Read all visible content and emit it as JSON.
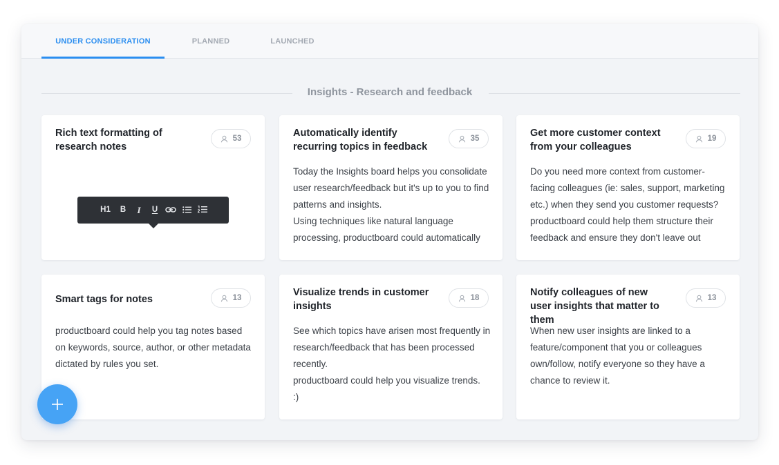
{
  "tabs": [
    {
      "label": "UNDER CONSIDERATION",
      "active": true
    },
    {
      "label": "PLANNED",
      "active": false
    },
    {
      "label": "LAUNCHED",
      "active": false
    }
  ],
  "section": {
    "title": "Insights - Research and feedback"
  },
  "colors": {
    "accent": "#2b8ef0",
    "fab": "#46a3f5",
    "toolbar": "#2e3136"
  },
  "cards": [
    {
      "title": "Rich text formatting of research notes",
      "votes": "53",
      "body": []
    },
    {
      "title": "Automatically identify recurring topics in feedback",
      "votes": "35",
      "body": [
        "Today the Insights board helps you consolidate user research/feedback but it's up to you to find patterns and insights.",
        "Using techniques like natural language processing, productboard could automatically"
      ]
    },
    {
      "title": "Get more customer context from your colleagues",
      "votes": "19",
      "body": [
        "Do you need more context from customer-facing colleagues (ie: sales, support, marketing etc.) when they send you customer requests? productboard could help them structure their feedback and ensure they don't leave out"
      ]
    },
    {
      "title": "Smart tags for notes",
      "votes": "13",
      "body": [
        "productboard could help you tag notes based on keywords, source, author, or other metadata dictated by rules you set."
      ]
    },
    {
      "title": "Visualize trends in customer insights",
      "votes": "18",
      "body": [
        "See which topics have arisen most frequently in research/feedback that has been processed recently.",
        "productboard could help you visualize trends.",
        ":)"
      ]
    },
    {
      "title": "Notify colleagues of new user insights that matter to them",
      "votes": "13",
      "body": [
        "When new user insights are linked to a feature/component that you or colleagues own/follow, notify everyone so they have a chance to review it."
      ]
    }
  ],
  "toolbar": {
    "h1": "H1",
    "bold": "B",
    "italic": "I",
    "underline": "U",
    "icons": [
      "link-icon",
      "bullet-list-icon",
      "numbered-list-icon"
    ]
  },
  "fab": {
    "icon": "plus-icon"
  }
}
